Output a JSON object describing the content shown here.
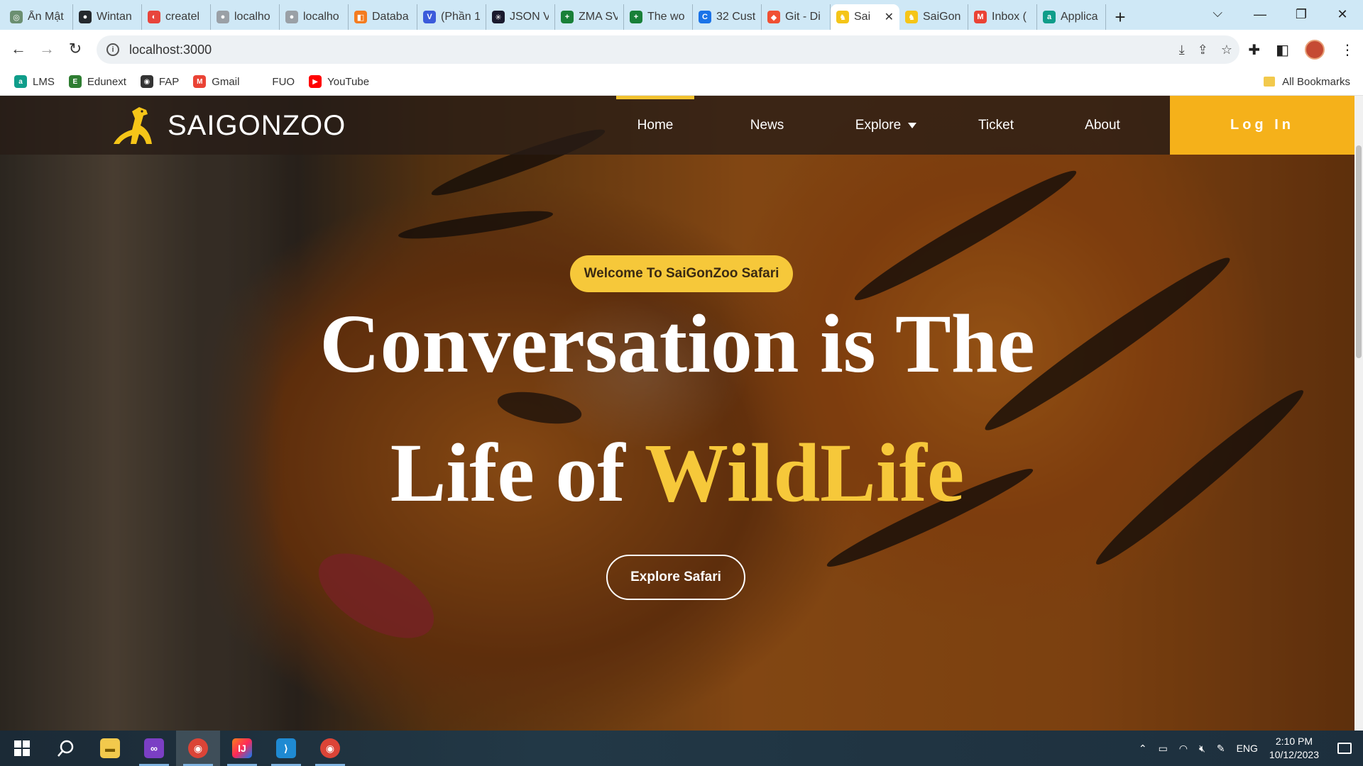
{
  "browser": {
    "tabs": [
      {
        "title": "Ẩn Mật",
        "fav_color": "#6b8f71",
        "fav_glyph": "◎"
      },
      {
        "title": "Wintan",
        "fav_color": "#24292e",
        "fav_glyph": "●"
      },
      {
        "title": "createl",
        "fav_color": "#e8453c",
        "fav_glyph": "◐"
      },
      {
        "title": "localho",
        "fav_color": "#9aa0a6",
        "fav_glyph": "●"
      },
      {
        "title": "localho",
        "fav_color": "#9aa0a6",
        "fav_glyph": "●"
      },
      {
        "title": "Databa",
        "fav_color": "#f47c20",
        "fav_glyph": "◧"
      },
      {
        "title": "(Phần 1",
        "fav_color": "#3b5bdb",
        "fav_glyph": "V"
      },
      {
        "title": "JSON V",
        "fav_color": "#1a1a2e",
        "fav_glyph": "✳"
      },
      {
        "title": "ZMA SV",
        "fav_color": "#188038",
        "fav_glyph": "+"
      },
      {
        "title": "The wo",
        "fav_color": "#188038",
        "fav_glyph": "+"
      },
      {
        "title": "32 Cust",
        "fav_color": "#1a73e8",
        "fav_glyph": "C"
      },
      {
        "title": "Git - Di",
        "fav_color": "#f05033",
        "fav_glyph": "◆"
      },
      {
        "title": "Sai",
        "fav_color": "#f5c518",
        "fav_glyph": "♞",
        "active": true
      },
      {
        "title": "SaiGon",
        "fav_color": "#f5c518",
        "fav_glyph": "♞"
      },
      {
        "title": "Inbox (",
        "fav_color": "#ea4335",
        "fav_glyph": "M"
      },
      {
        "title": "Applica",
        "fav_color": "#0f9d8a",
        "fav_glyph": "a"
      }
    ],
    "new_tab_icon": "+",
    "url": "localhost:3000",
    "bookmarks": [
      {
        "label": "LMS",
        "color": "#0f9d8a",
        "glyph": "a"
      },
      {
        "label": "Edunext",
        "color": "#2e7d32",
        "glyph": "E"
      },
      {
        "label": "FAP",
        "color": "#333333",
        "glyph": "◉"
      },
      {
        "label": "Gmail",
        "color": "#ea4335",
        "glyph": "M"
      },
      {
        "label": "FUO",
        "color": "#ffffff",
        "glyph": ""
      },
      {
        "label": "YouTube",
        "color": "#ff0000",
        "glyph": "▶"
      }
    ],
    "all_bookmarks_label": "All Bookmarks"
  },
  "site": {
    "logo_text": "SAIGONZOO",
    "nav": {
      "home": "Home",
      "news": "News",
      "explore": "Explore",
      "ticket": "Ticket",
      "about": "About"
    },
    "login_label": "Log In",
    "accent_color": "#f6c83a",
    "login_color": "#f5b11a"
  },
  "hero": {
    "welcome": "Welcome To SaiGonZoo Safari",
    "line1": "Conversation is The",
    "line2_prefix": "Life of ",
    "line2_accent": "WildLife",
    "cta": "Explore Safari"
  },
  "taskbar": {
    "apps": [
      "windows-start",
      "search",
      "file-explorer",
      "visual-studio",
      "chrome",
      "intellij",
      "vscode",
      "chrome-profile"
    ],
    "language": "ENG",
    "time": "2:10 PM",
    "date": "10/12/2023"
  }
}
